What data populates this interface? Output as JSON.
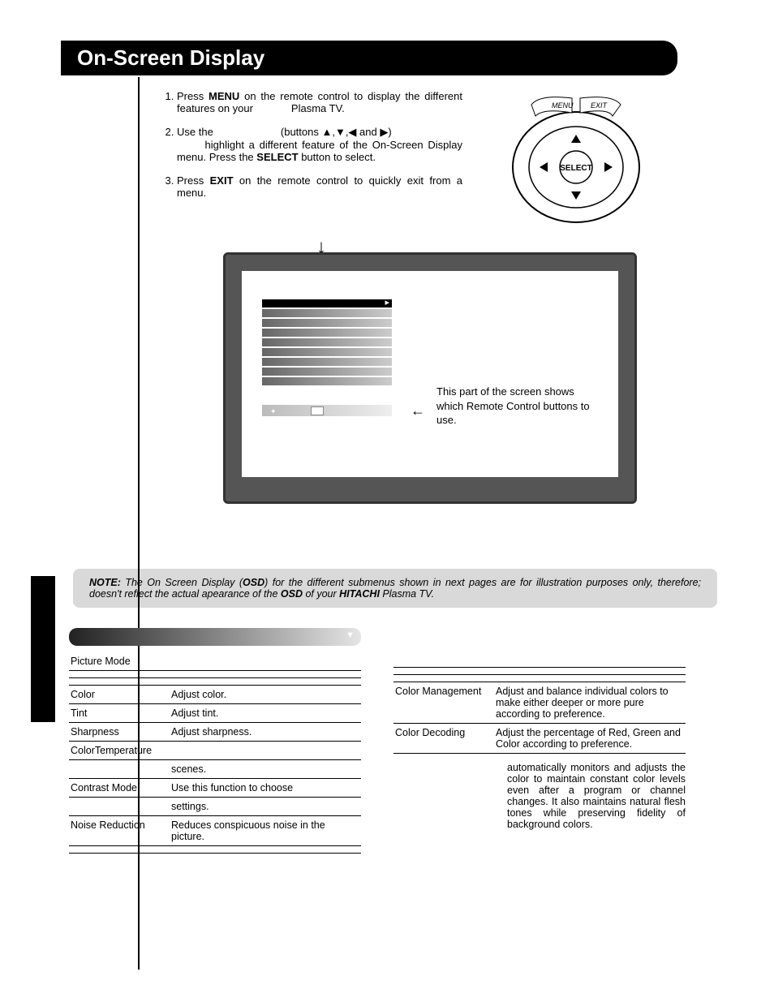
{
  "title": "On-Screen Display",
  "instructions": [
    {
      "pre": "Press ",
      "b": "MENU",
      "post": " on the remote control to display the different features on your",
      "tail": "Plasma TV."
    },
    {
      "pre": "Use the",
      "mid": "(buttons ▲,▼,◀ and ▶)",
      "line2": "highlight a different feature of the On-Screen Display menu. Press the ",
      "b2": "SELECT",
      "post2": " button to select."
    },
    {
      "pre": "Press ",
      "b": "EXIT",
      "post": " on the remote control to quickly exit from a menu."
    }
  ],
  "remote": {
    "menu": "MENU",
    "exit": "EXIT",
    "select": "SELECT"
  },
  "tv_annotation": "This part of the screen shows which Remote Control buttons to use.",
  "note": {
    "lead": "NOTE:",
    "text_a": "The On Screen Display (",
    "text_b": "OSD",
    "text_c": ") for the different submenus shown in next pages are for illustration purposes only, therefore; doesn't reflect the actual apearance of the ",
    "text_d": "OSD",
    "text_e": " of your ",
    "text_f": "HITACHI",
    "text_g": " Plasma TV."
  },
  "left_table": [
    {
      "label": "Picture Mode",
      "desc": ""
    },
    {
      "label": "",
      "desc": ""
    },
    {
      "label": "",
      "desc": ""
    },
    {
      "label": "Color",
      "desc": "Adjust color."
    },
    {
      "label": "Tint",
      "desc": "Adjust tint."
    },
    {
      "label": "Sharpness",
      "desc": "Adjust sharpness."
    },
    {
      "label": "ColorTemperature",
      "desc": ""
    },
    {
      "label": "",
      "desc": "scenes."
    },
    {
      "label": "Contrast  Mode",
      "desc": "Use this function to choose"
    },
    {
      "label": "",
      "desc": "settings."
    },
    {
      "label": "Noise Reduction",
      "desc": "Reduces conspicuous noise in the picture."
    },
    {
      "label": "",
      "desc": ""
    }
  ],
  "right_table": [
    {
      "label": "",
      "desc": ""
    },
    {
      "label": "",
      "desc": ""
    },
    {
      "label": "",
      "desc": ""
    },
    {
      "label": "Color Management",
      "desc": "Adjust and balance individual colors to make either deeper or more pure according to preference."
    },
    {
      "label": "Color Decoding",
      "desc": "Adjust the percentage of Red, Green and Color according to preference."
    }
  ],
  "right_para": "automatically monitors and adjusts the color to maintain constant color levels even after a program or channel changes. It also maintains natural flesh tones while preserving fidelity of background colors."
}
